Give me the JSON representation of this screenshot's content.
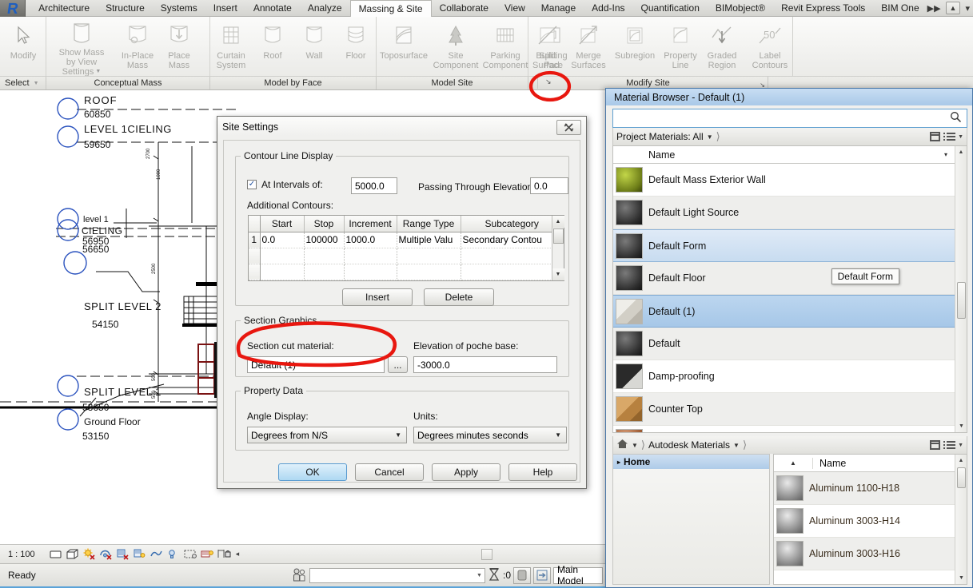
{
  "app": {
    "logo_glyph": "R"
  },
  "ribbon": {
    "tabs": [
      {
        "label": "Architecture",
        "active": false
      },
      {
        "label": "Structure",
        "active": false
      },
      {
        "label": "Systems",
        "active": false
      },
      {
        "label": "Insert",
        "active": false
      },
      {
        "label": "Annotate",
        "active": false
      },
      {
        "label": "Analyze",
        "active": false
      },
      {
        "label": "Massing & Site",
        "active": true
      },
      {
        "label": "Collaborate",
        "active": false
      },
      {
        "label": "View",
        "active": false
      },
      {
        "label": "Manage",
        "active": false
      },
      {
        "label": "Add-Ins",
        "active": false
      },
      {
        "label": "Quantification",
        "active": false
      },
      {
        "label": "BIMobject®",
        "active": false
      },
      {
        "label": "Revit Express Tools",
        "active": false
      },
      {
        "label": "BIM One",
        "active": false
      }
    ],
    "tab_overflow_icon": "double-chevron-right-icon",
    "tab_minimize_icon": "ribbon-minimize-icon",
    "buttons": {
      "modify": "Modify",
      "show_mass": "Show Mass\nby View Settings",
      "show_mass_l1": "Show Mass",
      "show_mass_l2": "by View Settings",
      "in_place_mass_l1": "In-Place",
      "in_place_mass_l2": "Mass",
      "place_mass_l1": "Place",
      "place_mass_l2": "Mass",
      "curtain_system_l1": "Curtain",
      "curtain_system_l2": "System",
      "roof": "Roof",
      "wall": "Wall",
      "floor": "Floor",
      "toposurface": "Toposurface",
      "site_component_l1": "Site",
      "site_component_l2": "Component",
      "parking_component_l1": "Parking",
      "parking_component_l2": "Component",
      "building_pad_l1": "Building",
      "building_pad_l2": "Pad",
      "split_surface_l1": "Split",
      "split_surface_l2": "Surface",
      "merge_surfaces_l1": "Merge",
      "merge_surfaces_l2": "Surfaces",
      "subregion": "Subregion",
      "property_line_l1": "Property",
      "property_line_l2": "Line",
      "graded_region_l1": "Graded",
      "graded_region_l2": "Region",
      "label_contours_l1": "Label",
      "label_contours_l2": "Contours",
      "label_contours_glyph": "50"
    },
    "panels": {
      "select": "Select",
      "conceptual_mass": "Conceptual Mass",
      "model_by_face": "Model by Face",
      "model_site": "Model Site",
      "modify_site": "Modify Site",
      "dialog_launcher_glyph": "↘"
    }
  },
  "canvas": {
    "levels": [
      {
        "name": "ROOF",
        "elevation": "60850"
      },
      {
        "name": "LEVEL 1CIELING",
        "elevation": "59650"
      },
      {
        "name": "level 1",
        "name2": "CIELING",
        "elevation": "56650",
        "elevation2": "56950"
      },
      {
        "name": "SPLIT LEVEL 2",
        "elevation": "54150"
      },
      {
        "name": "SPLIT LEVEL 1",
        "elevation": "53650"
      },
      {
        "name": "Ground Floor",
        "elevation": "53150"
      }
    ]
  },
  "view_control_bar": {
    "scale": "1 : 100",
    "icons": [
      "scale-icon",
      "detail-level-icon",
      "visual-style-icon",
      "sun-path-icon",
      "shadows-icon",
      "rendering-dialog-icon",
      "crop-view-icon",
      "show-crop-region-icon",
      "lightbulb-icon",
      "temporary-hide-isolate-icon",
      "reveal-hidden-elements-icon",
      "analytical-model-icon",
      "constraints-icon"
    ],
    "collapse_glyph": "◂"
  },
  "status_bar": {
    "ready": "Ready",
    "filter_icon": "filter-icon",
    "selector_value": "",
    "exclude_options_icon": "exclude-options-icon",
    "exclude_count": ":0",
    "design_option_icon": "design-option-icon",
    "worksets_icon": "worksets-icon",
    "main_model": "Main Model"
  },
  "site_settings": {
    "title": "Site Settings",
    "close_glyph": "✖",
    "contour_line_display": {
      "legend": "Contour Line Display",
      "at_intervals_label": "At Intervals of:",
      "at_intervals_checked": true,
      "at_intervals_value": "5000.0",
      "passing_through_label": "Passing Through Elevation:",
      "passing_through_value": "0.0",
      "additional_contours_label": "Additional Contours:",
      "columns": [
        "",
        "Start",
        "Stop",
        "Increment",
        "Range Type",
        "Subcategory"
      ],
      "rows": [
        {
          "n": "1",
          "start": "0.0",
          "stop": "100000",
          "increment": "1000.0",
          "range_type": "Multiple Valu",
          "subcategory": "Secondary Contou"
        }
      ],
      "insert_button": "Insert",
      "delete_button": "Delete"
    },
    "section_graphics": {
      "legend": "Section Graphics",
      "section_cut_material_label": "Section cut material:",
      "section_cut_material_value": "Default (1)",
      "browse_button": "...",
      "elevation_poche_label": "Elevation of poche base:",
      "elevation_poche_value": "-3000.0"
    },
    "property_data": {
      "legend": "Property Data",
      "angle_display_label": "Angle Display:",
      "angle_display_value": "Degrees from N/S",
      "units_label": "Units:",
      "units_value": "Degrees minutes seconds"
    },
    "footer": {
      "ok": "OK",
      "cancel": "Cancel",
      "apply": "Apply",
      "help": "Help"
    }
  },
  "material_browser": {
    "title": "Material Browser - Default (1)",
    "search_placeholder": "",
    "search_value": "",
    "search_icon": "search-icon",
    "project_crumb": "Project Materials: All",
    "autodesk_crumb": "Autodesk Materials",
    "home_crumb_icon": "home-icon",
    "panel_toggle_icon": "panel-toggle-icon",
    "view_list_icon": "view-list-icon",
    "name_column": "Name",
    "sort_caret": "▾",
    "project_materials": [
      {
        "name": "Default Mass Exterior Wall",
        "swatch": "#7e8f2a",
        "state": "normal"
      },
      {
        "name": "Default Light Source",
        "swatch": "#3b3b3b",
        "state": "alt"
      },
      {
        "name": "Default Form",
        "swatch": "#3b3b3b",
        "state": "sel-light"
      },
      {
        "name": "Default Floor",
        "swatch": "#3b3b3b",
        "state": "alt"
      },
      {
        "name": "Default (1)",
        "swatch": "#d8d5cf",
        "state": "sel-strong"
      },
      {
        "name": "Default",
        "swatch": "#3b3b3b",
        "state": "alt"
      },
      {
        "name": "Damp-proofing",
        "swatch": "#1b1b1b",
        "state": "normal"
      },
      {
        "name": "Counter Top",
        "swatch": "#c2884c",
        "state": "alt"
      }
    ],
    "tooltip_text": "Default Form",
    "home_label": "Home",
    "home_expand_glyph": "▸",
    "autodesk_materials": [
      {
        "name": "Aluminum 1100-H18",
        "swatch": "#8d8d8d",
        "state": "alt"
      },
      {
        "name": "Aluminum 3003-H14",
        "swatch": "#8d8d8d",
        "state": "normal"
      },
      {
        "name": "Aluminum 3003-H16",
        "swatch": "#8d8d8d",
        "state": "alt"
      }
    ]
  },
  "annotations": {
    "color": "#e8170f",
    "marks": [
      "ribbon-dialog-launcher-circle",
      "section-cut-material-circle"
    ]
  }
}
